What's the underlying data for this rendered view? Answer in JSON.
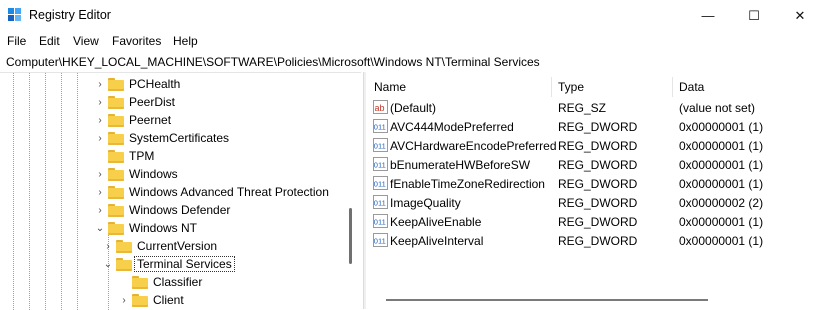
{
  "window": {
    "title": "Registry Editor",
    "controls": {
      "minimize": "—",
      "maximize": "☐",
      "close": "✕"
    }
  },
  "menu": [
    "File",
    "Edit",
    "View",
    "Favorites",
    "Help"
  ],
  "address": "Computer\\HKEY_LOCAL_MACHINE\\SOFTWARE\\Policies\\Microsoft\\Windows NT\\Terminal Services",
  "tree": {
    "items": [
      {
        "label": "PCHealth",
        "expander": "›"
      },
      {
        "label": "PeerDist",
        "expander": "›"
      },
      {
        "label": "Peernet",
        "expander": "›"
      },
      {
        "label": "SystemCertificates",
        "expander": "›"
      },
      {
        "label": "TPM",
        "expander": ""
      },
      {
        "label": "Windows",
        "expander": "›"
      },
      {
        "label": "Windows Advanced Threat Protection",
        "expander": "›"
      },
      {
        "label": "Windows Defender",
        "expander": "›"
      },
      {
        "label": "Windows NT",
        "expander": "⌄"
      },
      {
        "label": "CurrentVersion",
        "expander": "›"
      },
      {
        "label": "Terminal Services",
        "expander": "⌄"
      },
      {
        "label": "Classifier",
        "expander": ""
      },
      {
        "label": "Client",
        "expander": "›"
      }
    ]
  },
  "list": {
    "headers": {
      "name": "Name",
      "type": "Type",
      "data": "Data"
    },
    "rows": [
      {
        "icon": "string-value-icon",
        "name": "(Default)",
        "type": "REG_SZ",
        "data": "(value not set)"
      },
      {
        "icon": "dword-value-icon",
        "name": "AVC444ModePreferred",
        "type": "REG_DWORD",
        "data": "0x00000001 (1)"
      },
      {
        "icon": "dword-value-icon",
        "name": "AVCHardwareEncodePreferred",
        "type": "REG_DWORD",
        "data": "0x00000001 (1)"
      },
      {
        "icon": "dword-value-icon",
        "name": "bEnumerateHWBeforeSW",
        "type": "REG_DWORD",
        "data": "0x00000001 (1)"
      },
      {
        "icon": "dword-value-icon",
        "name": "fEnableTimeZoneRedirection",
        "type": "REG_DWORD",
        "data": "0x00000001 (1)"
      },
      {
        "icon": "dword-value-icon",
        "name": "ImageQuality",
        "type": "REG_DWORD",
        "data": "0x00000002 (2)"
      },
      {
        "icon": "dword-value-icon",
        "name": "KeepAliveEnable",
        "type": "REG_DWORD",
        "data": "0x00000001 (1)"
      },
      {
        "icon": "dword-value-icon",
        "name": "KeepAliveInterval",
        "type": "REG_DWORD",
        "data": "0x00000001 (1)"
      }
    ],
    "string_icon_text": "ab",
    "dword_icon_text": "011"
  },
  "colors": {
    "folder": "#f8cf4b",
    "icon_blue": "#1f5fbf",
    "icon_red": "#c0392b"
  }
}
